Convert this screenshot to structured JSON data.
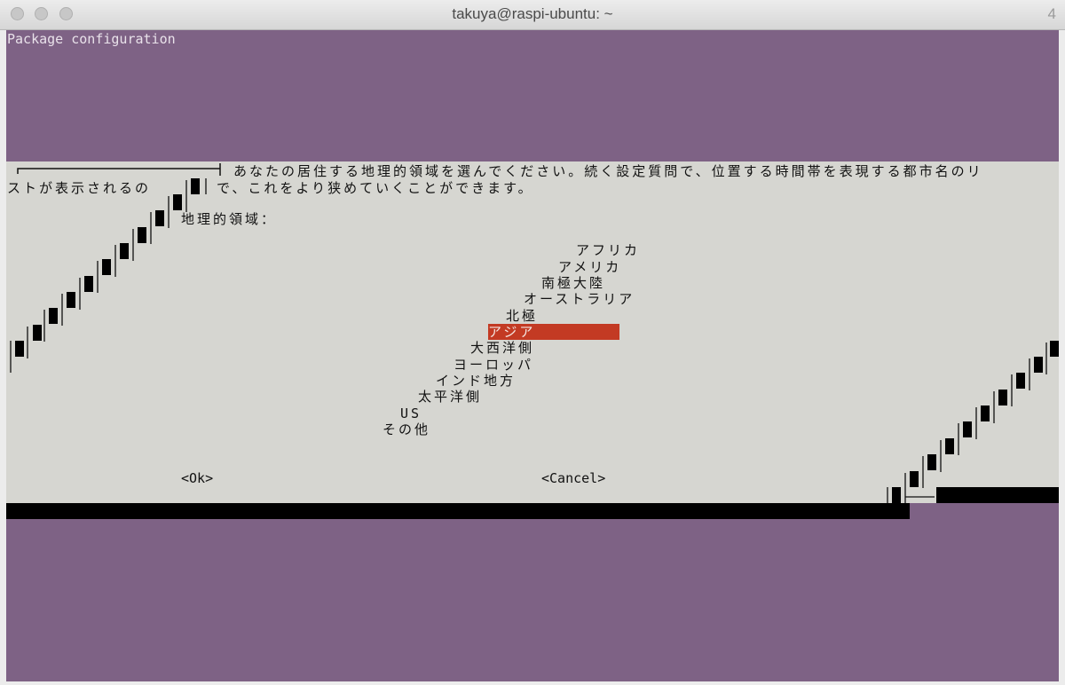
{
  "window": {
    "title": "takuya@raspi-ubuntu: ~",
    "tab_number": "4"
  },
  "terminal": {
    "backtitle": "Package configuration"
  },
  "dialog": {
    "prompt_line1": "あなたの居住する地理的領域を選んでください。続く設定質問で、位置する時間帯を表現する都市名のリ",
    "prompt_line2a": "ストが表示されるの",
    "prompt_line2b": "で、これをより狭めていくことができます。",
    "list_label": "地理的領域：",
    "items": [
      {
        "label": "アフリカ"
      },
      {
        "label": "アメリカ"
      },
      {
        "label": "南極大陸"
      },
      {
        "label": "オーストラリア"
      },
      {
        "label": "北極"
      },
      {
        "label": "アジア",
        "selected": true
      },
      {
        "label": "大西洋側"
      },
      {
        "label": "ヨーロッパ"
      },
      {
        "label": "インド地方"
      },
      {
        "label": "太平洋側"
      },
      {
        "label": "US"
      },
      {
        "label": "その他"
      }
    ],
    "ok_label": "<Ok>",
    "cancel_label": "<Cancel>"
  },
  "colors": {
    "terminal_bg": "#7e6285",
    "dialog_bg": "#d6d6d1",
    "selection": "#c33a23"
  }
}
